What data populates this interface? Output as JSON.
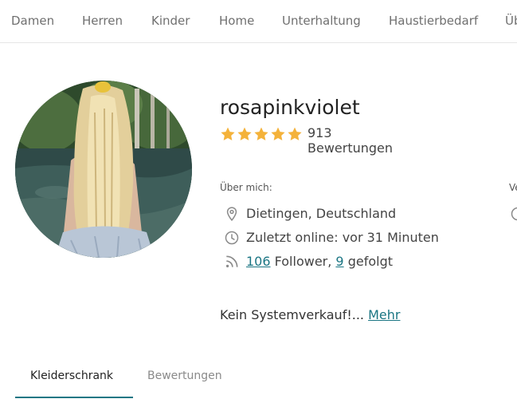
{
  "nav": {
    "items": [
      "Damen",
      "Herren",
      "Kinder",
      "Home",
      "Unterhaltung",
      "Haustierbedarf",
      "Üb"
    ]
  },
  "profile": {
    "username": "rosapinkviolet",
    "rating": {
      "stars": 5,
      "max_stars": 5,
      "count_text": "913 Bewertungen"
    },
    "about_label": "Über mich:",
    "location": "Dietingen, Deutschland",
    "last_online": "Zuletzt online: vor 31 Minuten",
    "followers_count": "106",
    "followers_label": " Follower, ",
    "following_count": "9",
    "following_label": " gefolgt",
    "bio_text": "Kein Systemverkauf!... ",
    "more_link": "Mehr",
    "cut_label": "Ve"
  },
  "tabs": [
    {
      "label": "Kleiderschrank",
      "active": true
    },
    {
      "label": "Bewertungen",
      "active": false
    }
  ],
  "colors": {
    "accent": "#1a7583",
    "star": "#f4b23a",
    "icon": "#8a8a8a"
  },
  "icons": [
    "map-pin-icon",
    "clock-icon",
    "rss-icon",
    "star-icon"
  ]
}
